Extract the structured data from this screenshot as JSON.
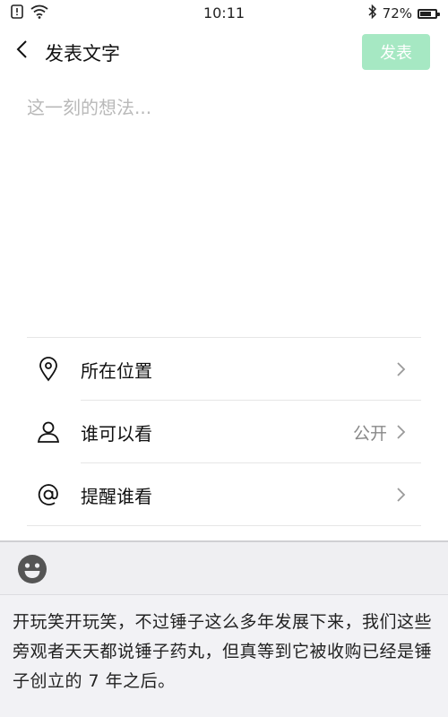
{
  "status_bar": {
    "time": "10:11",
    "battery_percent": "72%",
    "battery_level": 0.72,
    "icons": [
      "alert-icon",
      "wifi-icon",
      "bluetooth-icon",
      "battery-icon"
    ]
  },
  "header": {
    "title": "发表文字",
    "publish_label": "发表",
    "publish_color": "#a6e8c3"
  },
  "composer": {
    "placeholder": "这一刻的想法...",
    "value": ""
  },
  "options": [
    {
      "icon": "location-pin-icon",
      "label": "所在位置",
      "value": ""
    },
    {
      "icon": "person-icon",
      "label": "谁可以看",
      "value": "公开"
    },
    {
      "icon": "at-sign-icon",
      "label": "提醒谁看",
      "value": ""
    }
  ],
  "keyboard": {
    "emoji_icon": "emoji-face-icon",
    "suggestion_text": "开玩笑开玩笑，不过锤子这么多年发展下来，我们这些旁观者天天都说锤子药丸，但真等到它被收购已经是锤子创立的 7 年之后。"
  }
}
